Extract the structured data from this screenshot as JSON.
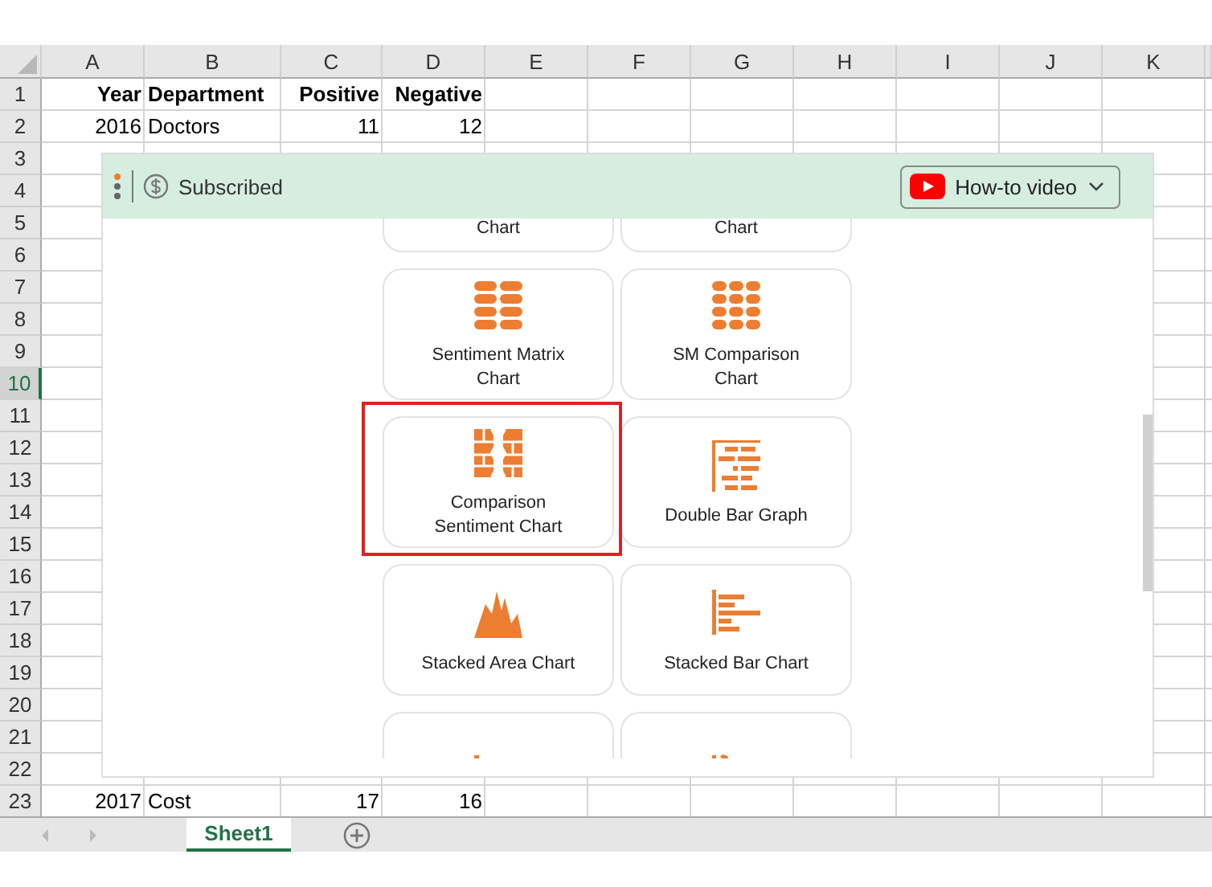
{
  "sheet": {
    "columns": [
      {
        "label": "A",
        "kind": "number"
      },
      {
        "label": "B",
        "kind": "text"
      },
      {
        "label": "C",
        "kind": "number"
      },
      {
        "label": "D",
        "kind": "number"
      },
      {
        "label": "E"
      },
      {
        "label": "F"
      },
      {
        "label": "G"
      },
      {
        "label": "H"
      },
      {
        "label": "I"
      },
      {
        "label": "J"
      },
      {
        "label": "K"
      }
    ],
    "rows": [
      {
        "number": "1",
        "selected": false,
        "bold": true,
        "cells": {
          "A": "Year",
          "B": "Department",
          "C": "Positive",
          "D": "Negative"
        }
      },
      {
        "number": "2",
        "selected": false,
        "bold": false,
        "cells": {
          "A": "2016",
          "B": "Doctors",
          "C": "11",
          "D": "12"
        }
      },
      {
        "number": "3",
        "selected": false
      },
      {
        "number": "4",
        "selected": false
      },
      {
        "number": "5",
        "selected": false
      },
      {
        "number": "6",
        "selected": false
      },
      {
        "number": "7",
        "selected": false
      },
      {
        "number": "8",
        "selected": false
      },
      {
        "number": "9",
        "selected": false
      },
      {
        "number": "10",
        "selected": true
      },
      {
        "number": "11",
        "selected": false
      },
      {
        "number": "12",
        "selected": false
      },
      {
        "number": "13",
        "selected": false
      },
      {
        "number": "14",
        "selected": false
      },
      {
        "number": "15",
        "selected": false
      },
      {
        "number": "16",
        "selected": false
      },
      {
        "number": "17",
        "selected": false
      },
      {
        "number": "18",
        "selected": false
      },
      {
        "number": "19",
        "selected": false
      },
      {
        "number": "20",
        "selected": false
      },
      {
        "number": "21",
        "selected": false
      },
      {
        "number": "22",
        "selected": false
      },
      {
        "number": "23",
        "selected": false,
        "bold": false,
        "cells": {
          "A": "2017",
          "B": "Cost",
          "C": "17",
          "D": "16"
        }
      }
    ],
    "tabs": [
      {
        "label": "Sheet1",
        "selected": true
      }
    ]
  },
  "panel": {
    "status": "Subscribed",
    "video_button": "How-to video",
    "charts": [
      {
        "label": "Chart",
        "kind": "none",
        "selected": false
      },
      {
        "label": "Chart",
        "kind": "none",
        "selected": false
      },
      {
        "label": "Sentiment Matrix Chart",
        "kind": "matrix",
        "selected": false
      },
      {
        "label": "SM Comparison Chart",
        "kind": "sm-matrix",
        "selected": false
      },
      {
        "label": "Comparison Sentiment Chart",
        "kind": "comparison",
        "selected": true
      },
      {
        "label": "Double Bar Graph",
        "kind": "double-bar",
        "selected": false
      },
      {
        "label": "Stacked Area Chart",
        "kind": "area",
        "selected": false
      },
      {
        "label": "Stacked Bar Chart",
        "kind": "stacked-bar",
        "selected": false
      },
      {
        "kind": "columns",
        "selected": false
      },
      {
        "kind": "trend",
        "selected": false
      }
    ]
  }
}
